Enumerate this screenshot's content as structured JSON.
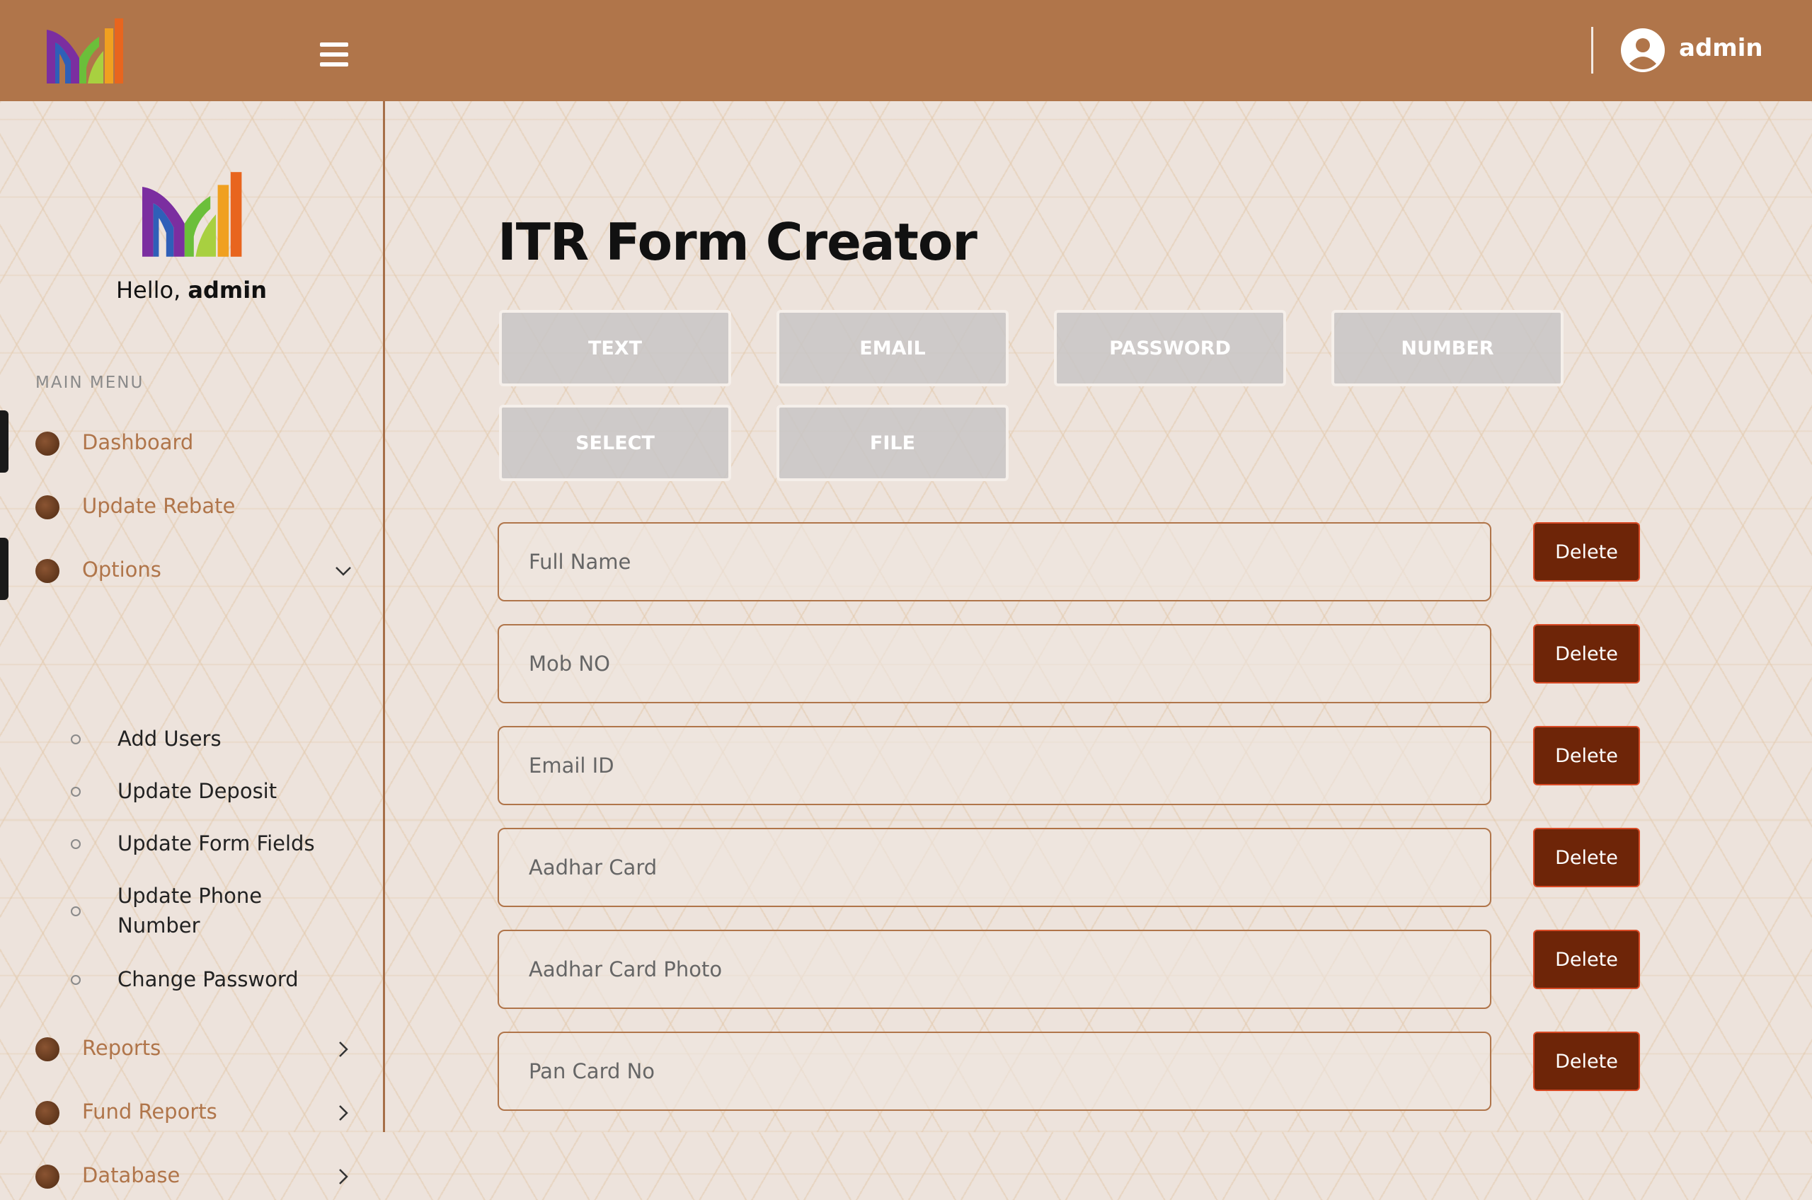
{
  "header": {
    "user_name": "admin",
    "colors": {
      "bar": "#b0754a",
      "text": "#ffffff"
    }
  },
  "sidebar": {
    "greeting": "Hello,",
    "greeting_name": "admin",
    "section_label": "MAIN MENU",
    "items": [
      {
        "label": "Dashboard",
        "icon": "bullet-dot-icon"
      },
      {
        "label": "Update Rebate",
        "icon": "bullet-dot-icon"
      },
      {
        "label": "Options",
        "icon": "bullet-dot-icon",
        "expanded": true,
        "chevron": "chevron-down-icon"
      },
      {
        "label": "Reports",
        "icon": "bullet-dot-icon",
        "chevron": "chevron-right-icon"
      },
      {
        "label": "Fund Reports",
        "icon": "bullet-dot-icon",
        "chevron": "chevron-right-icon"
      },
      {
        "label": "Database",
        "icon": "bullet-dot-icon",
        "chevron": "chevron-right-icon"
      }
    ],
    "sub_items": [
      {
        "label": "Add Users"
      },
      {
        "label": "Update Deposit"
      },
      {
        "label": "Update Form Fields"
      },
      {
        "label": "Update Phone\nNumber"
      },
      {
        "label": "Change Password"
      }
    ],
    "accent_color": "#b0754a"
  },
  "main": {
    "title": "ITR Form Creator",
    "field_types": [
      "TEXT",
      "EMAIL",
      "PASSWORD",
      "NUMBER",
      "SELECT",
      "FILE"
    ],
    "fields": [
      {
        "placeholder": "Full Name",
        "delete_label": "Delete"
      },
      {
        "placeholder": "Mob NO",
        "delete_label": "Delete"
      },
      {
        "placeholder": "Email ID",
        "delete_label": "Delete"
      },
      {
        "placeholder": "Aadhar Card",
        "delete_label": "Delete"
      },
      {
        "placeholder": "Aadhar Card Photo",
        "delete_label": "Delete"
      },
      {
        "placeholder": "Pan Card No",
        "delete_label": "Delete"
      }
    ],
    "delete_color": "#6e2508"
  }
}
